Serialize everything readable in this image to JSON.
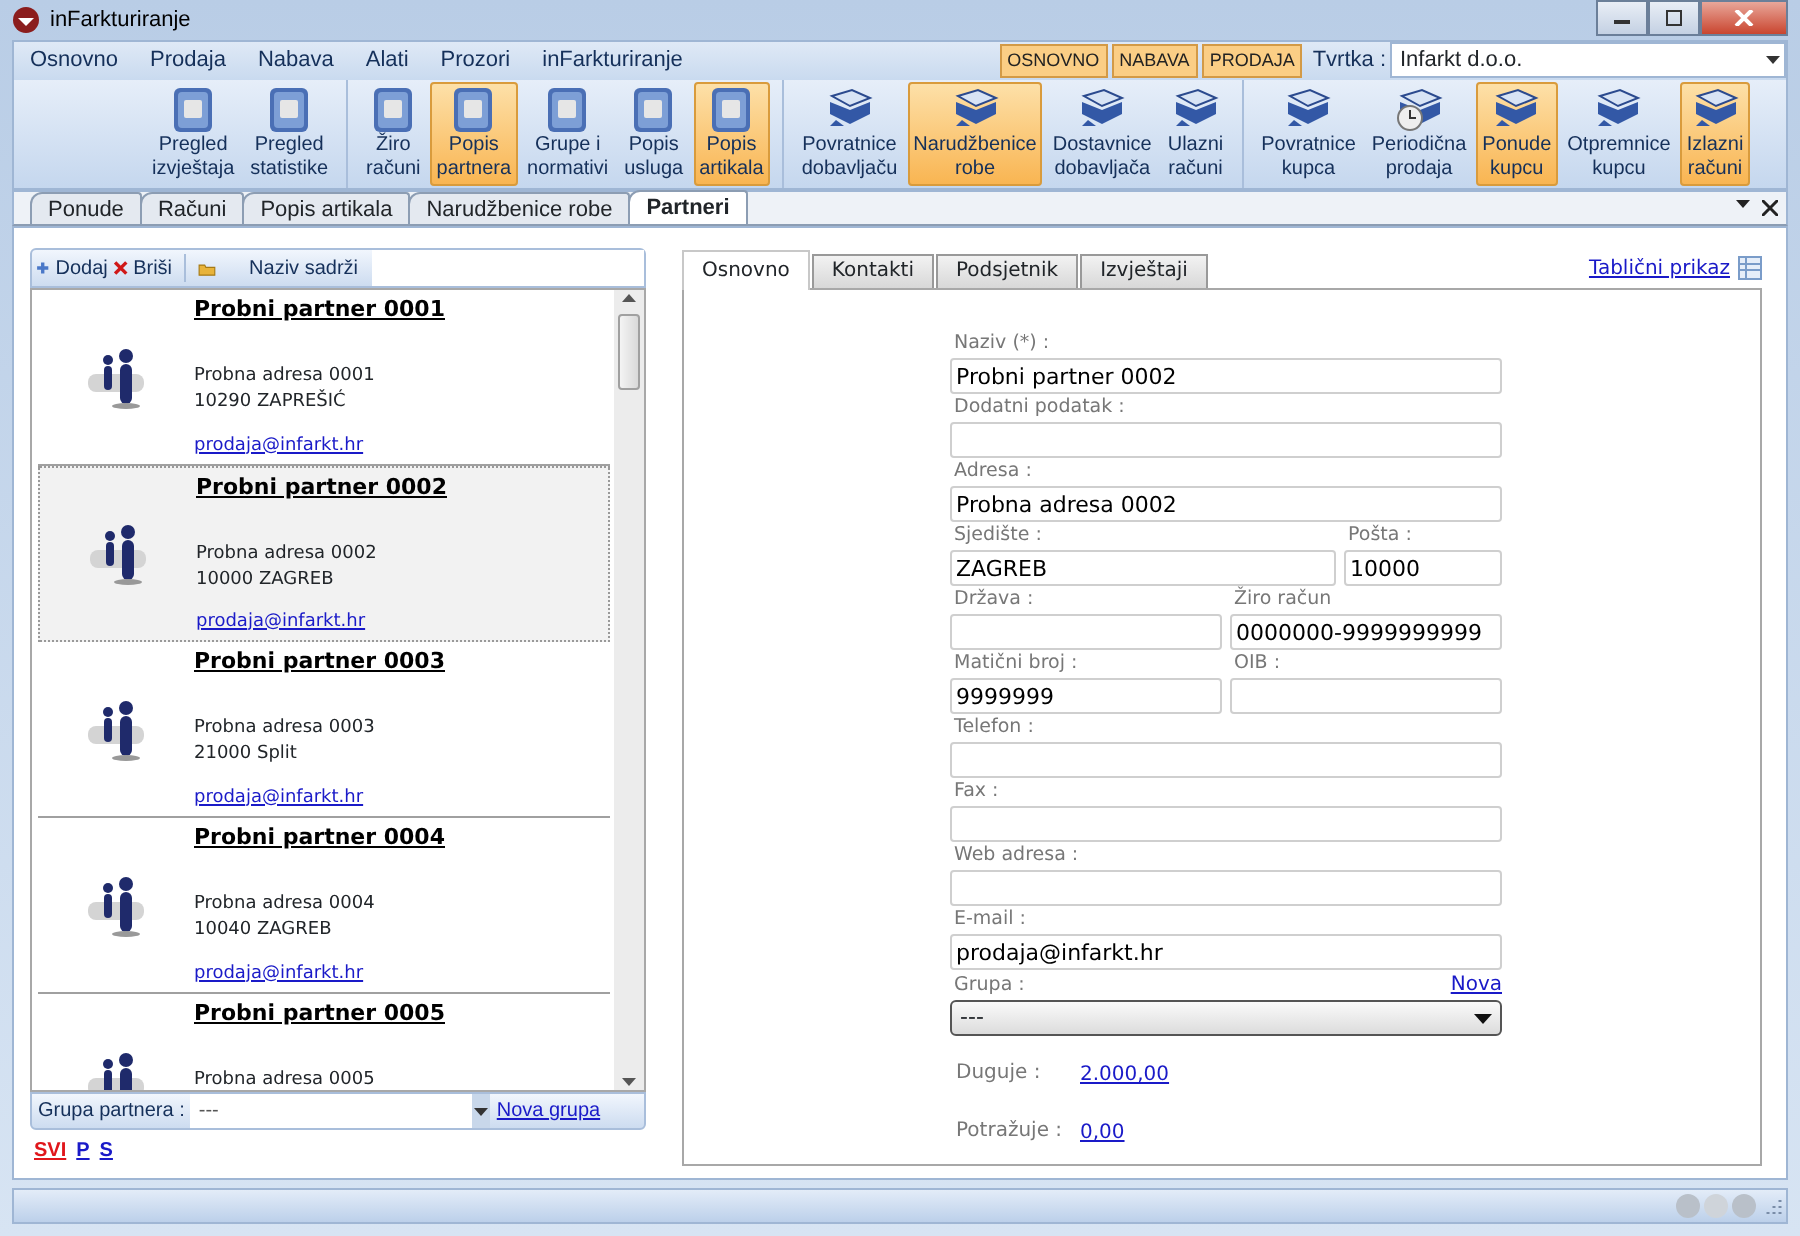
{
  "window": {
    "title": "inFarkturiranje"
  },
  "menu": [
    "Osnovno",
    "Prodaja",
    "Nabava",
    "Alati",
    "Prozori",
    "inFarkturiranje"
  ],
  "modules": [
    "OSNOVNO",
    "NABAVA",
    "PRODAJA"
  ],
  "company": {
    "label": "Tvrtka :",
    "value": "Infarkt d.o.o."
  },
  "ribbon_groups": [
    [
      {
        "label": "Pregled\nizvještaja",
        "kind": "book",
        "active": false
      },
      {
        "label": "Pregled\nstatistike",
        "kind": "book",
        "active": false
      }
    ],
    [
      {
        "label": "Žiro\nračuni",
        "kind": "book",
        "active": false
      },
      {
        "label": "Popis\npartnera",
        "kind": "book",
        "active": true
      },
      {
        "label": "Grupe i\nnormativi",
        "kind": "book",
        "active": false
      },
      {
        "label": "Popis\nusluga",
        "kind": "book",
        "active": false
      },
      {
        "label": "Popis\nartikala",
        "kind": "book",
        "active": true
      }
    ],
    [
      {
        "label": "Povratnice\ndobavljaču",
        "kind": "tray",
        "active": false
      },
      {
        "label": "Narudžbenice\nrobe",
        "kind": "tray",
        "active": true
      },
      {
        "label": "Dostavnice\ndobavljača",
        "kind": "tray",
        "active": false
      },
      {
        "label": "Ulazni\nračuni",
        "kind": "tray",
        "active": false
      }
    ],
    [
      {
        "label": "Povratnice\nkupca",
        "kind": "tray",
        "active": false
      },
      {
        "label": "Periodična\nprodaja",
        "kind": "tray-clock",
        "active": false
      },
      {
        "label": "Ponude\nkupcu",
        "kind": "tray",
        "active": true
      },
      {
        "label": "Otpremnice\nkupcu",
        "kind": "tray",
        "active": false
      },
      {
        "label": "Izlazni\nračuni",
        "kind": "tray",
        "active": true
      }
    ]
  ],
  "doc_tabs": [
    {
      "label": "Ponude",
      "selected": false
    },
    {
      "label": "Računi",
      "selected": false
    },
    {
      "label": "Popis artikala",
      "selected": false
    },
    {
      "label": "Narudžbenice robe",
      "selected": false
    },
    {
      "label": "Partneri",
      "selected": true
    }
  ],
  "partner_toolbar": {
    "add": "Dodaj",
    "delete": "Briši",
    "search_label": "Naziv sadrži"
  },
  "partners": [
    {
      "name": "Probni partner 0001",
      "address": "Probna adresa 0001",
      "city": "10290 ZAPREŠIĆ",
      "email": "prodaja@infarkt.hr",
      "selected": false
    },
    {
      "name": "Probni partner 0002",
      "address": "Probna adresa 0002",
      "city": "10000 ZAGREB",
      "email": "prodaja@infarkt.hr",
      "selected": true
    },
    {
      "name": "Probni partner 0003",
      "address": "Probna adresa 0003",
      "city": "21000 Split",
      "email": "prodaja@infarkt.hr",
      "selected": false
    },
    {
      "name": "Probni partner 0004",
      "address": "Probna adresa 0004",
      "city": "10040 ZAGREB",
      "email": "prodaja@infarkt.hr",
      "selected": false
    },
    {
      "name": "Probni partner 0005",
      "address": "Probna adresa 0005",
      "selected": false
    }
  ],
  "group_filter": {
    "label": "Grupa partnera :",
    "value": "---",
    "link": "Nova grupa"
  },
  "letter_filter": [
    {
      "label": "SVI",
      "selected": true
    },
    {
      "label": "P",
      "selected": false
    },
    {
      "label": "S",
      "selected": false
    }
  ],
  "form_tabs": [
    {
      "label": "Osnovno",
      "selected": true
    },
    {
      "label": "Kontakti",
      "selected": false
    },
    {
      "label": "Podsjetnik",
      "selected": false
    },
    {
      "label": "Izvještaji",
      "selected": false
    }
  ],
  "table_view_link": "Tablični prikaz",
  "form_rows": [
    {
      "kind": "full",
      "fields": [
        {
          "label": "Naziv (*) :",
          "value": "Probni partner 0002"
        }
      ]
    },
    {
      "kind": "full",
      "fields": [
        {
          "label": "Dodatni podatak :"
        }
      ]
    },
    {
      "kind": "full",
      "fields": [
        {
          "label": "Adresa :",
          "value": "Probna adresa 0002"
        }
      ]
    },
    {
      "kind": "wide-narrow",
      "fields": [
        {
          "label": "Sjedište :",
          "value": "ZAGREB"
        },
        {
          "label": "Pošta :",
          "value": "10000"
        }
      ]
    },
    {
      "kind": "halves",
      "fields": [
        {
          "label": "Država :"
        },
        {
          "label": "Žiro račun",
          "value": "0000000-9999999999"
        }
      ]
    },
    {
      "kind": "halves",
      "fields": [
        {
          "label": "Matični broj :",
          "value": "9999999"
        },
        {
          "label": "OIB :"
        }
      ]
    },
    {
      "kind": "full",
      "fields": [
        {
          "label": "Telefon :"
        }
      ]
    },
    {
      "kind": "full",
      "fields": [
        {
          "label": "Fax :"
        }
      ]
    },
    {
      "kind": "full",
      "fields": [
        {
          "label": "Web adresa :"
        }
      ]
    },
    {
      "kind": "full",
      "fields": [
        {
          "label": "E-mail :",
          "value": "prodaja@infarkt.hr"
        }
      ]
    }
  ],
  "group_select": {
    "label": "Grupa :",
    "link": "Nova",
    "value": "---"
  },
  "balances": [
    {
      "label": "Duguje :",
      "value": "2.000,00"
    },
    {
      "label": "Potražuje :",
      "value": "0,00"
    }
  ]
}
